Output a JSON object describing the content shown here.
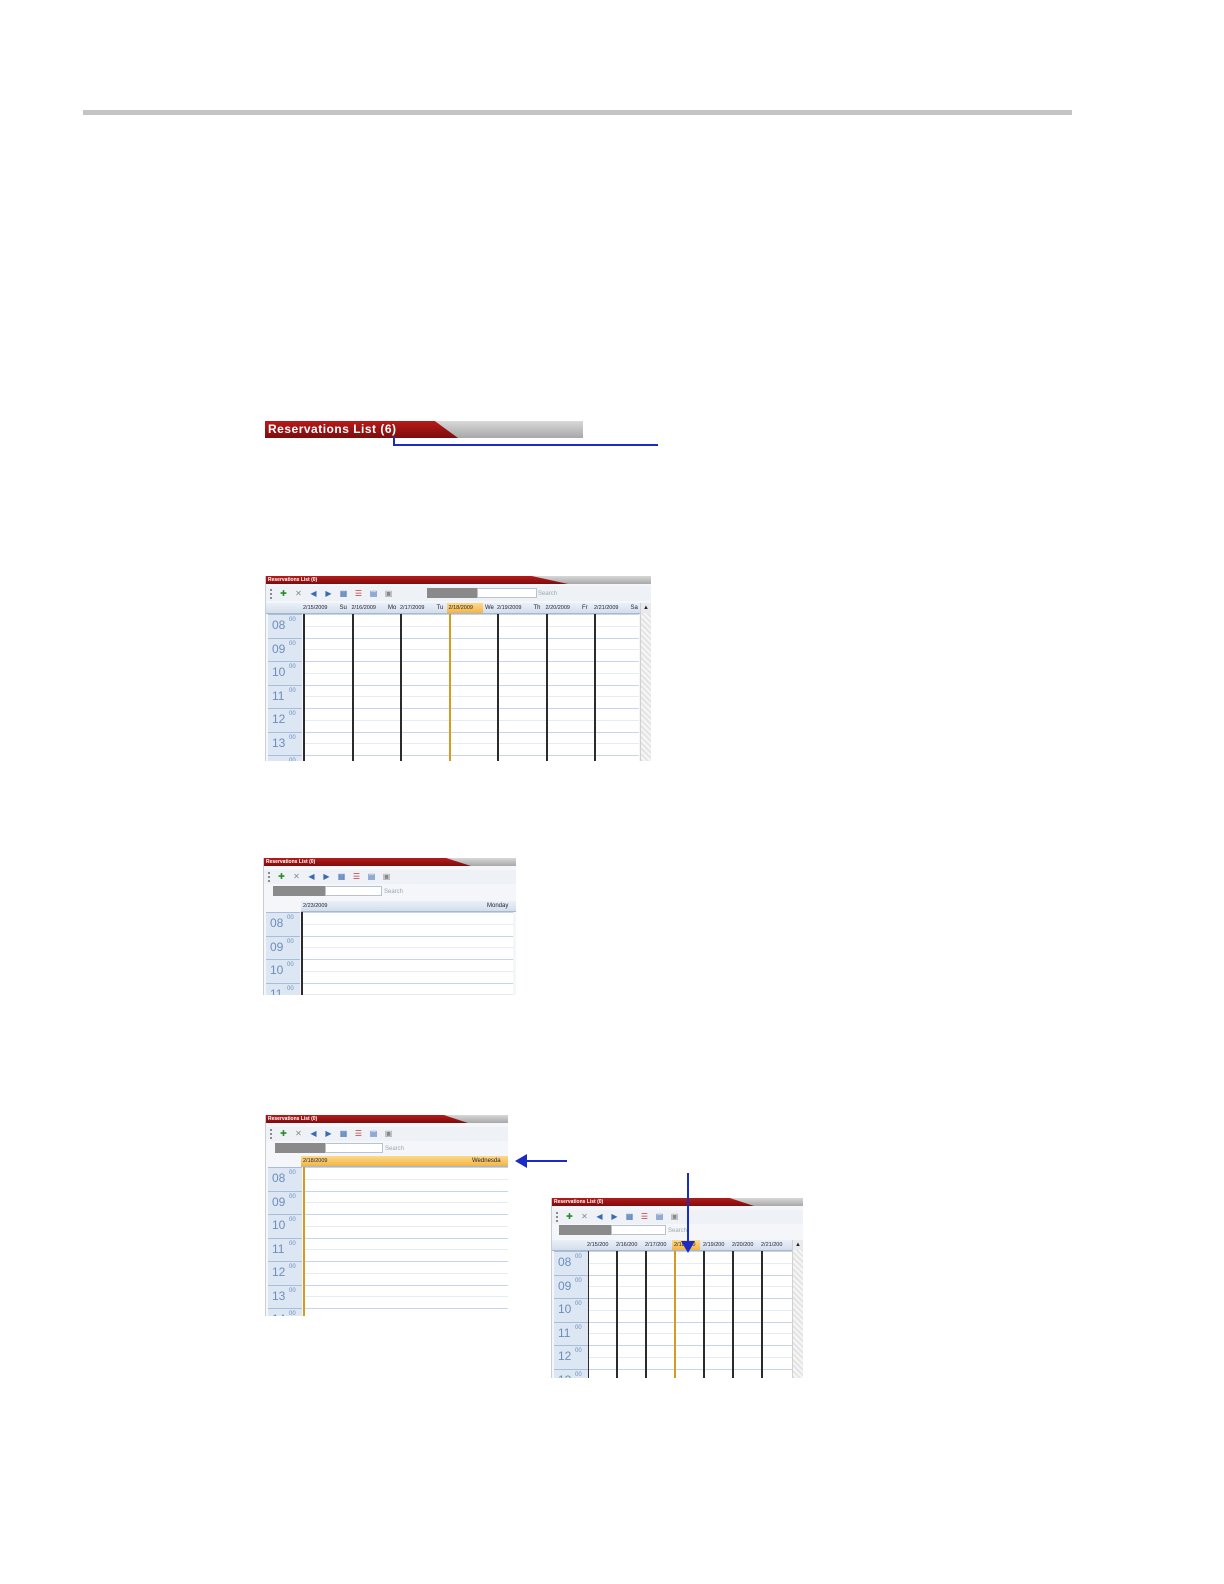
{
  "title": "Reservations List (6)",
  "panel_title": "Reservations List (0)",
  "search_label": "Search",
  "toolbar_icons": [
    "new-reservation-icon",
    "delete-icon",
    "previous-icon",
    "next-icon",
    "day-view-icon",
    "week-view-icon",
    "list-view-icon",
    "today-icon"
  ],
  "hours": [
    "08",
    "09",
    "10",
    "11",
    "12",
    "13",
    "14"
  ],
  "minutes": "00",
  "week_view": {
    "dates": [
      "2/15/2009",
      "2/16/2009",
      "2/17/2009",
      "2/18/2009",
      "2/19/2009",
      "2/20/2009",
      "2/21/2009"
    ],
    "day_names": [
      "Su",
      "Mo",
      "Tu",
      "We",
      "Th",
      "Fr",
      "Sa"
    ]
  },
  "day_view": {
    "date": "2/23/2009",
    "day_name": "Monday"
  },
  "today_view": {
    "date": "2/18/2009",
    "day_name": "Wednesda"
  },
  "week_view_small": {
    "dates": [
      "2/15/200",
      "2/16/200",
      "2/17/200",
      "2/18/200",
      "2/19/200",
      "2/20/200",
      "2/21/200"
    ]
  }
}
